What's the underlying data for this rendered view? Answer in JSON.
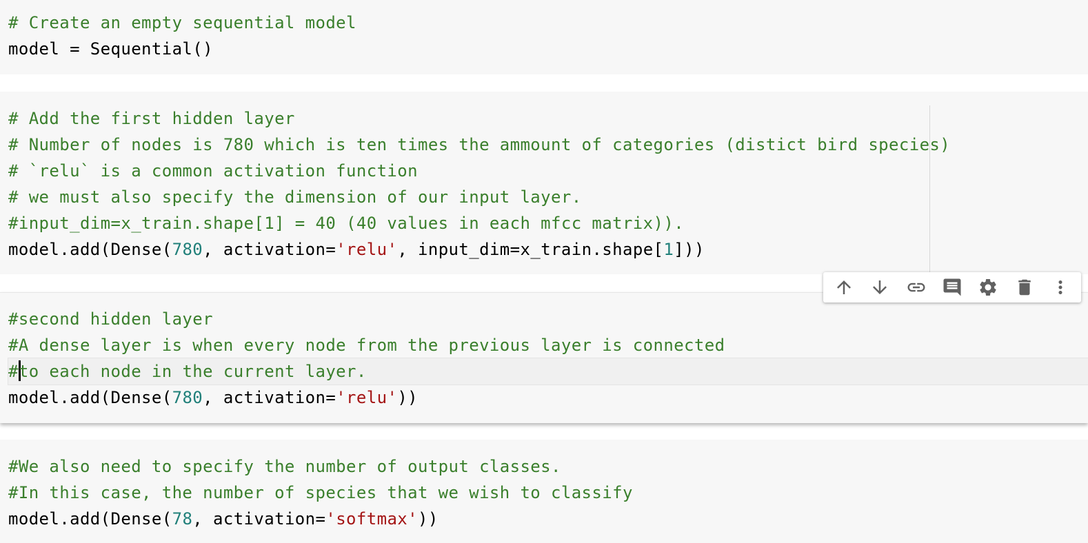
{
  "cells": [
    {
      "lines": [
        [
          {
            "t": "cm",
            "v": "# Create an empty sequential model"
          }
        ],
        [
          {
            "t": "plain",
            "v": "model = Sequential()"
          }
        ]
      ]
    },
    {
      "lines": [
        [
          {
            "t": "cm",
            "v": "# Add the first hidden layer"
          }
        ],
        [
          {
            "t": "cm",
            "v": "# Number of nodes is 780 which is ten times the ammount of categories (distict bird species)"
          }
        ],
        [
          {
            "t": "cm",
            "v": "# `relu` is a common activation function"
          }
        ],
        [
          {
            "t": "cm",
            "v": "# we must also specify the dimension of our input layer."
          }
        ],
        [
          {
            "t": "cm",
            "v": "#input_dim=x_train.shape[1] = 40 (40 values in each mfcc matrix))."
          }
        ],
        [
          {
            "t": "plain",
            "v": "model.add(Dense("
          },
          {
            "t": "num",
            "v": "780"
          },
          {
            "t": "plain",
            "v": ", activation="
          },
          {
            "t": "str",
            "v": "'relu'"
          },
          {
            "t": "plain",
            "v": ", input_dim=x_train.shape["
          },
          {
            "t": "num",
            "v": "1"
          },
          {
            "t": "plain",
            "v": "]))"
          }
        ]
      ]
    },
    {
      "lines": [
        [
          {
            "t": "cm",
            "v": "#second hidden layer"
          }
        ],
        [
          {
            "t": "cm",
            "v": "#A dense layer is when every node from the previous layer is connected"
          }
        ],
        [
          {
            "t": "cm",
            "v": "#"
          },
          {
            "t": "caret",
            "v": ""
          },
          {
            "t": "cm",
            "v": "to each node in the current layer."
          }
        ],
        [
          {
            "t": "plain",
            "v": "model.add(Dense("
          },
          {
            "t": "num",
            "v": "780"
          },
          {
            "t": "plain",
            "v": ", activation="
          },
          {
            "t": "str",
            "v": "'relu'"
          },
          {
            "t": "plain",
            "v": "))"
          }
        ]
      ]
    },
    {
      "lines": [
        [
          {
            "t": "cm",
            "v": "#We also need to specify the number of output classes."
          }
        ],
        [
          {
            "t": "cm",
            "v": "#In this case, the number of species that we wish to classify"
          }
        ],
        [
          {
            "t": "plain",
            "v": "model.add(Dense("
          },
          {
            "t": "num",
            "v": "78"
          },
          {
            "t": "plain",
            "v": ", activation="
          },
          {
            "t": "str",
            "v": "'softmax'"
          },
          {
            "t": "plain",
            "v": "))"
          }
        ]
      ]
    }
  ],
  "colors": {
    "comment": "#3a7f2c",
    "number": "#21807a",
    "string": "#a41515",
    "cell_bg": "#f7f7f7",
    "icon": "#616161"
  },
  "toolbar": {
    "icons": [
      "arrow-up-icon",
      "arrow-down-icon",
      "link-icon",
      "comment-icon",
      "gear-icon",
      "trash-icon",
      "more-vert-icon"
    ]
  }
}
